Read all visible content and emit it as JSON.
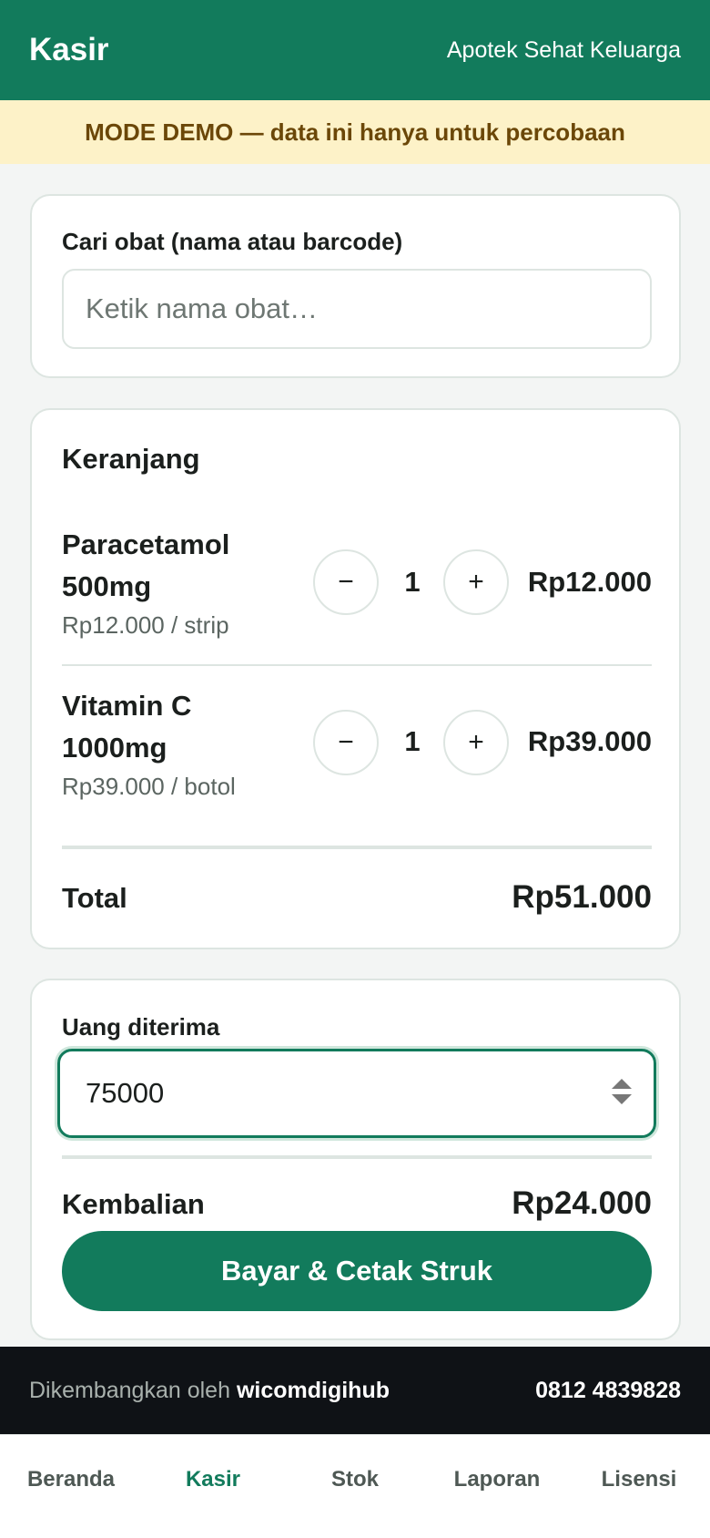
{
  "header": {
    "title": "Kasir",
    "store_name": "Apotek Sehat Keluarga"
  },
  "demo_banner": "MODE DEMO — data ini hanya untuk percobaan",
  "search": {
    "label": "Cari obat (nama atau barcode)",
    "placeholder": "Ketik nama obat…"
  },
  "cart": {
    "title": "Keranjang",
    "items": [
      {
        "name": "Paracetamol 500mg",
        "unit_price": "Rp12.000 / strip",
        "qty": "1",
        "subtotal": "Rp12.000",
        "minus": "−",
        "plus": "+"
      },
      {
        "name": "Vitamin C 1000mg",
        "unit_price": "Rp39.000 / botol",
        "qty": "1",
        "subtotal": "Rp39.000",
        "minus": "−",
        "plus": "+"
      }
    ],
    "total_label": "Total",
    "total_value": "Rp51.000"
  },
  "payment": {
    "label": "Uang diterima",
    "value": "75000",
    "change_label": "Kembalian",
    "change_value": "Rp24.000",
    "pay_button": "Bayar & Cetak Struk"
  },
  "footer": {
    "prefix": "Dikembangkan oleh",
    "brand": "wicomdigihub",
    "phone": "0812 4839828"
  },
  "nav": {
    "items": [
      {
        "label": "Beranda"
      },
      {
        "label": "Kasir",
        "active": true
      },
      {
        "label": "Stok"
      },
      {
        "label": "Laporan"
      },
      {
        "label": "Lisensi"
      }
    ]
  },
  "colors": {
    "primary": "#127b5c",
    "demo_bg": "#fdf2c8",
    "demo_text": "#6b4708",
    "footer_bg": "#0f1216"
  }
}
